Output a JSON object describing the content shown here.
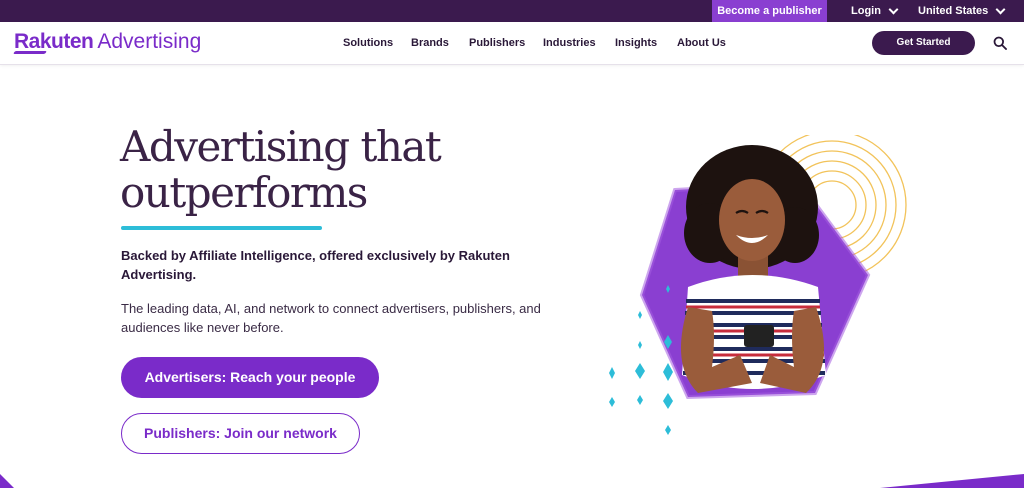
{
  "utility": {
    "become_publisher": "Become a publisher",
    "login": "Login",
    "region": "United States"
  },
  "nav": {
    "logo_bold": "Rakuten",
    "logo_light": "Advertising",
    "items": [
      {
        "label": "Solutions"
      },
      {
        "label": "Brands"
      },
      {
        "label": "Publishers"
      },
      {
        "label": "Industries"
      },
      {
        "label": "Insights"
      },
      {
        "label": "About Us"
      }
    ],
    "cta": "Get Started",
    "search_icon": "search-icon"
  },
  "hero": {
    "title_line1": "Advertising that",
    "title_line2": "outperforms",
    "lead": "Backed by Affiliate Intelligence, offered exclusively by Rakuten Advertising.",
    "body": "The leading data, AI, and network to connect advertisers, publishers, and audiences like never before.",
    "primary_cta": "Advertisers: Reach your people",
    "secondary_cta": "Publishers: Join our network",
    "image_alt": "smiling woman holding a phone"
  },
  "colors": {
    "brand_purple": "#7a2bc9",
    "dark_purple": "#3b1a4e",
    "accent_cyan": "#2dbdd8",
    "accent_gold": "#f2c35a"
  }
}
